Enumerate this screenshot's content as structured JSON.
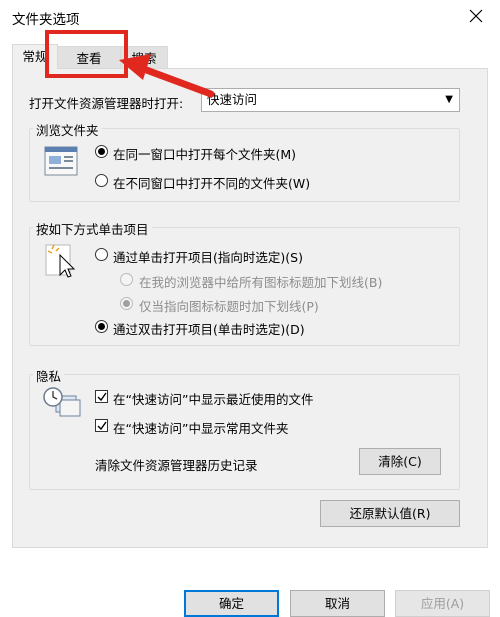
{
  "window": {
    "title": "文件夹选项"
  },
  "tabs": [
    {
      "label": "常规",
      "active": true
    },
    {
      "label": "查看",
      "active": false
    },
    {
      "label": "搜索",
      "active": false
    }
  ],
  "open_explorer": {
    "label": "打开文件资源管理器时打开:",
    "value": "快速访问"
  },
  "browse_folders": {
    "title": "浏览文件夹",
    "options": [
      {
        "label": "在同一窗口中打开每个文件夹(M)",
        "checked": true
      },
      {
        "label": "在不同窗口中打开不同的文件夹(W)",
        "checked": false
      }
    ]
  },
  "click_items": {
    "title": "按如下方式单击项目",
    "single_click": {
      "label": "通过单击打开项目(指向时选定)(S)",
      "checked": false
    },
    "underline_all": {
      "label": "在我的浏览器中给所有图标标题加下划线(B)",
      "checked": false,
      "disabled": true
    },
    "underline_point": {
      "label": "仅当指向图标标题时加下划线(P)",
      "checked": true,
      "disabled": true
    },
    "double_click": {
      "label": "通过双击打开项目(单击时选定)(D)",
      "checked": true
    }
  },
  "privacy": {
    "title": "隐私",
    "recent_files": {
      "label": "在“快速访问”中显示最近使用的文件",
      "checked": true
    },
    "frequent_folders": {
      "label": "在“快速访问”中显示常用文件夹",
      "checked": true
    },
    "clear_label": "清除文件资源管理器历史记录",
    "clear_button": "清除(C)"
  },
  "restore_defaults": "还原默认值(R)",
  "footer": {
    "ok": "确定",
    "cancel": "取消",
    "apply": "应用(A)"
  },
  "annotation": {
    "color": "#e0281f"
  }
}
